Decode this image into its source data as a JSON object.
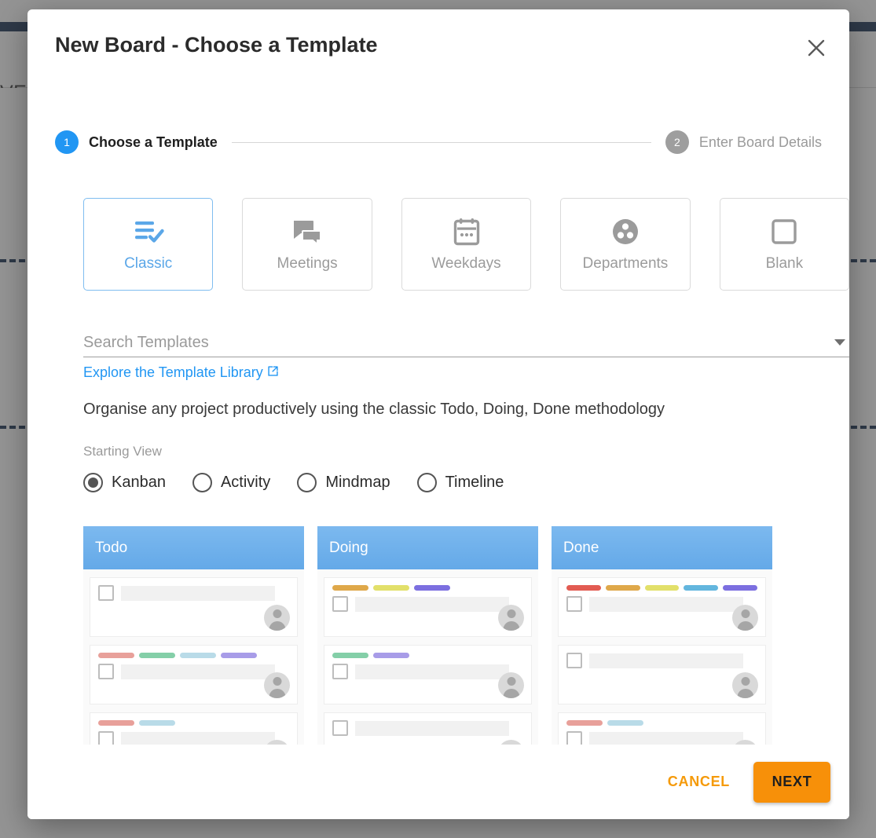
{
  "background": {
    "partial_title": "VE"
  },
  "modal": {
    "title": "New Board - Choose a Template",
    "close_icon": "close-icon"
  },
  "stepper": {
    "steps": [
      {
        "number": "1",
        "label": "Choose a Template",
        "state": "active"
      },
      {
        "number": "2",
        "label": "Enter Board Details",
        "state": "inactive"
      }
    ],
    "active_color": "#2196f3",
    "inactive_color": "#9e9e9e"
  },
  "templates": {
    "selected": "Classic",
    "cards": [
      {
        "label": "Classic",
        "icon": "playlist-add-check-icon",
        "selected": true
      },
      {
        "label": "Meetings",
        "icon": "chat-bubbles-icon",
        "selected": false
      },
      {
        "label": "Weekdays",
        "icon": "calendar-icon",
        "selected": false
      },
      {
        "label": "Departments",
        "icon": "bubble-chart-icon",
        "selected": false
      },
      {
        "label": "Blank",
        "icon": "empty-square-icon",
        "selected": false
      }
    ]
  },
  "search": {
    "placeholder": "Search Templates",
    "value": "",
    "dropdown_icon": "chevron-down-icon"
  },
  "library_link": {
    "text": "Explore the Template Library",
    "icon": "external-link-icon",
    "color": "#2196f3"
  },
  "description": "Organise any project productively using the classic Todo, Doing, Done methodology",
  "starting_view": {
    "label": "Starting View",
    "selected": "Kanban",
    "options": [
      {
        "label": "Kanban",
        "selected": true
      },
      {
        "label": "Activity",
        "selected": false
      },
      {
        "label": "Mindmap",
        "selected": false
      },
      {
        "label": "Timeline",
        "selected": false
      }
    ]
  },
  "kanban_preview": {
    "label_palette": {
      "red": "#e25b52",
      "red_muted": "#e8a09a",
      "orange": "#dfa84a",
      "yellow": "#e2e06a",
      "green": "#84cfa8",
      "blue": "#63b6de",
      "blue_muted": "#b9dbe8",
      "purple": "#7c6fe0",
      "purple_muted": "#a89ce8"
    },
    "columns": [
      {
        "title": "Todo",
        "cards": [
          {
            "labels": []
          },
          {
            "labels": [
              "red_muted",
              "green",
              "blue_muted",
              "purple_muted"
            ]
          },
          {
            "labels": [
              "red_muted",
              "blue_muted"
            ]
          }
        ]
      },
      {
        "title": "Doing",
        "cards": [
          {
            "labels": [
              "orange",
              "yellow",
              "purple"
            ]
          },
          {
            "labels": [
              "green",
              "purple_muted"
            ]
          },
          {
            "labels": []
          }
        ]
      },
      {
        "title": "Done",
        "cards": [
          {
            "labels": [
              "red",
              "orange",
              "yellow",
              "blue",
              "purple"
            ]
          },
          {
            "labels": []
          },
          {
            "labels": [
              "red_muted",
              "blue_muted"
            ]
          }
        ]
      }
    ]
  },
  "footer": {
    "cancel_label": "CANCEL",
    "next_label": "NEXT",
    "accent_color": "#f79009"
  }
}
